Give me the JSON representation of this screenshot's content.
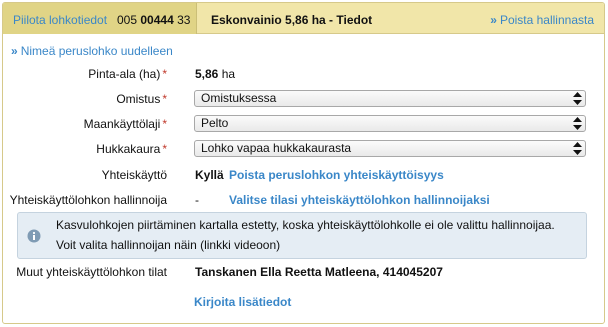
{
  "header": {
    "toggle_label": "Piilota lohkotiedot",
    "code_prefix": "005",
    "code_bold": "00444",
    "code_suffix": "33",
    "title": "Eskonvainio 5,86 ha - Tiedot",
    "remove_label": "Poista hallinnasta",
    "remove_chevron": "»"
  },
  "rename": {
    "chevron": "»",
    "label": "Nimeä peruslohko uudelleen"
  },
  "fields": {
    "area": {
      "label": "Pinta-ala (ha)",
      "required": "*",
      "value_bold": "5,86",
      "unit": "ha"
    },
    "ownership": {
      "label": "Omistus",
      "required": "*",
      "value": "Omistuksessa"
    },
    "land_use": {
      "label": "Maankäyttölaji",
      "required": "*",
      "value": "Pelto"
    },
    "wild_oat": {
      "label": "Hukkakaura",
      "required": "*",
      "value": "Lohko vapaa hukkakaurasta"
    },
    "joint_use": {
      "label": "Yhteiskäyttö",
      "value": "Kyllä",
      "link": "Poista peruslohkon yhteiskäyttöisyys"
    },
    "joint_admin": {
      "label": "Yhteiskäyttölohkon hallinnoija",
      "value": "-",
      "link": "Valitse tilasi yhteiskäyttölohkon hallinnoijaksi"
    }
  },
  "info": {
    "line1": "Kasvulohkojen piirtäminen kartalla estetty, koska yhteiskäyttölohkolle ei ole valittu hallinnoijaa.",
    "line2": "Voit valita hallinnoijan näin (linkki videoon)"
  },
  "other_farms": {
    "label": "Muut yhteiskäyttölohkon tilat",
    "value": "Tanskanen Ella Reetta Matleena, 414045207",
    "link": "Kirjoita lisätiedot"
  },
  "colors": {
    "link": "#3a87c8",
    "header_bg": "#f1e6a9",
    "info_bg": "#e5edf4",
    "required": "#c0392b"
  }
}
